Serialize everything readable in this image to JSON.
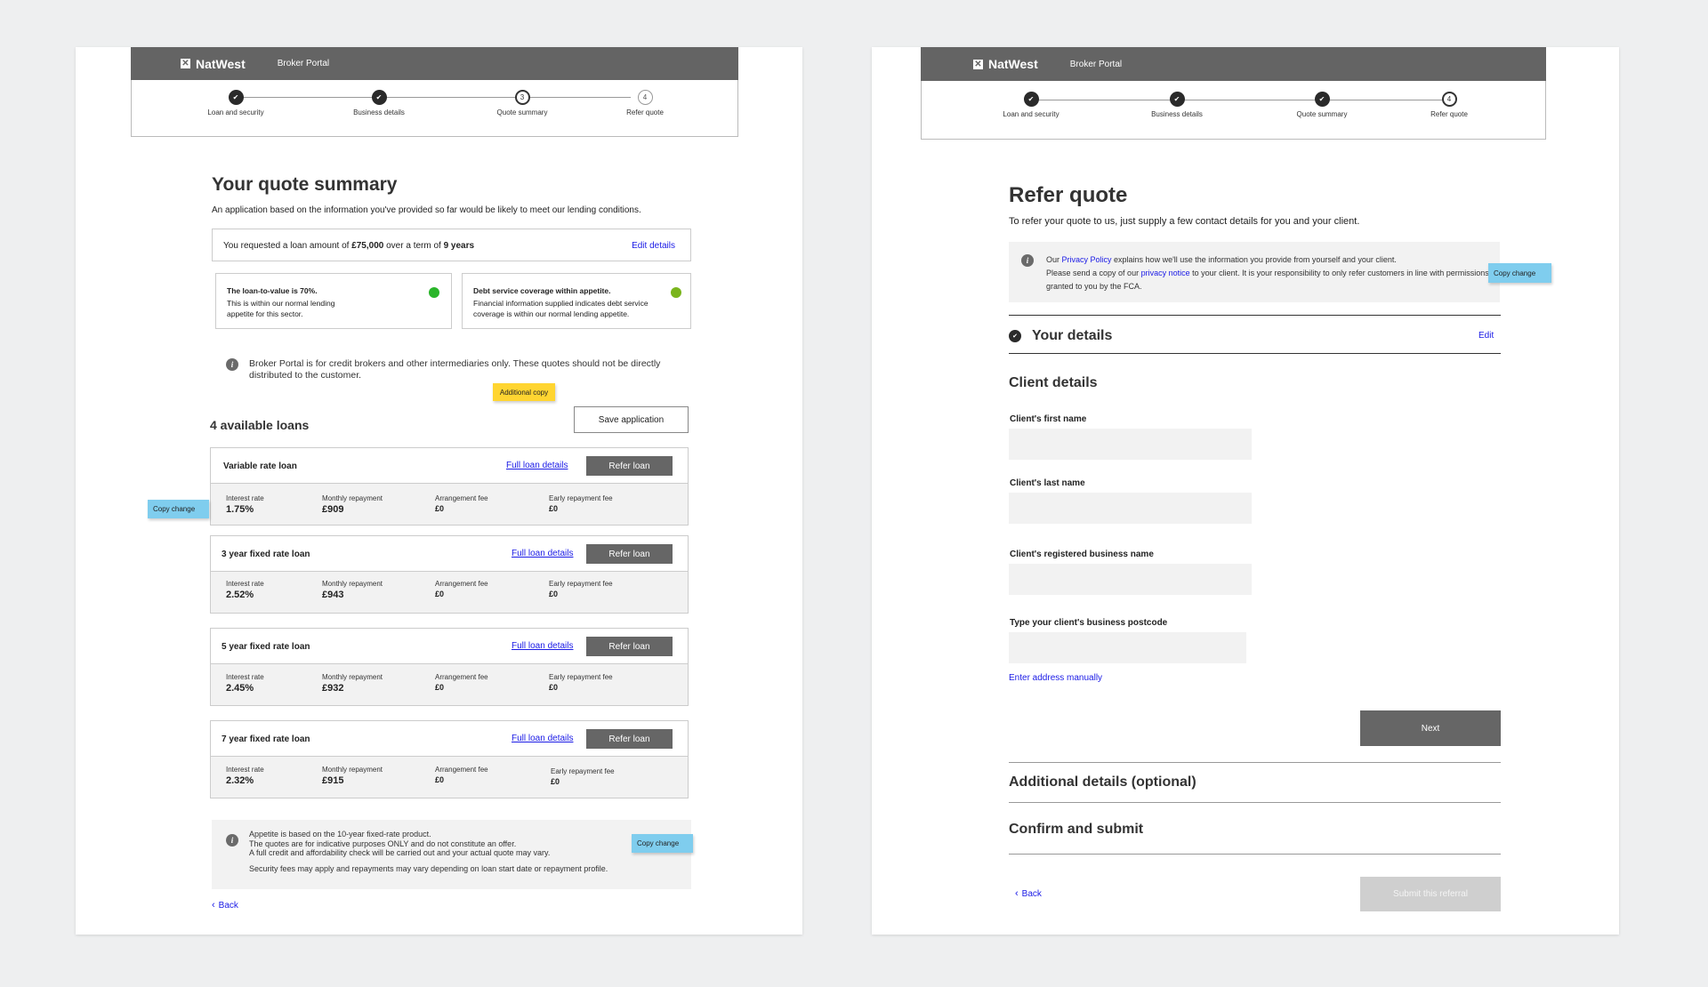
{
  "brand": "NatWest",
  "portal": "Broker Portal",
  "steps": [
    "Loan and security",
    "Business details",
    "Quote summary",
    "Refer quote"
  ],
  "step_numbers": [
    "3",
    "4"
  ],
  "left": {
    "title": "Your quote summary",
    "intro": "An application based on the information you've provided so far would be likely to meet our lending conditions.",
    "request_prefix": "You requested a loan amount of ",
    "amount": "£75,000",
    "request_mid": " over a term of ",
    "term": "9 years",
    "edit_details": "Edit details",
    "ltv_title": "The loan-to-value is 70%.",
    "ltv_body": "This is within our normal lending appetite for this sector.",
    "dsc_title": "Debt service coverage within appetite.",
    "dsc_body": "Financial information supplied indicates debt service coverage is within our normal lending appetite.",
    "status_color": "#2ab52a",
    "status_color_2": "#7ab51d",
    "notice": "Broker Portal is for credit brokers and other intermediaries only. These quotes should not be directly distributed to the customer.",
    "sticky_additional": "Additional copy",
    "available": "4 available loans",
    "save": "Save application",
    "full_details": "Full loan details",
    "refer": "Refer loan",
    "col_labels": [
      "Interest rate",
      "Monthly repayment",
      "Arrangement fee",
      "Early repayment fee"
    ],
    "loans": [
      {
        "name": "Variable rate loan",
        "rate": "1.75%",
        "monthly": "£909",
        "arr": "£0",
        "early": "£0"
      },
      {
        "name": "3 year fixed rate loan",
        "rate": "2.52%",
        "monthly": "£943",
        "arr": "£0",
        "early": "£0"
      },
      {
        "name": "5 year fixed rate loan",
        "rate": "2.45%",
        "monthly": "£932",
        "arr": "£0",
        "early": "£0"
      },
      {
        "name": "7 year fixed rate loan",
        "rate": "2.32%",
        "monthly": "£915",
        "arr": "£0",
        "early": "£0"
      }
    ],
    "sticky_copy": "Copy change",
    "appetite_1": "Appetite is based on the 10-year fixed-rate product.",
    "appetite_2": "The quotes are for indicative purposes ONLY and do not constitute an offer.",
    "appetite_3": "A full credit and affordability check will be carried out and your actual quote may vary.",
    "appetite_4": "Security fees may apply and repayments may vary depending on loan start date or repayment profile.",
    "back": "Back"
  },
  "right": {
    "title": "Refer quote",
    "intro": "To refer your quote to us, just supply a few contact details for you and your client.",
    "privacy_1": "Our ",
    "privacy_link": "Privacy Policy",
    "privacy_2": " explains how we'll use the information you provide from yourself and your client.",
    "privacy_3": "Please send a copy of our ",
    "privacy_notice": "privacy notice",
    "privacy_4": " to your client. It is your responsibility to only refer customers in line with permissions granted to you by the FCA.",
    "sticky_copy": "Copy change",
    "your_details": "Your details",
    "edit": "Edit",
    "client_details": "Client details",
    "first_name": "Client's first name",
    "last_name": "Client's last name",
    "business_name": "Client's registered business name",
    "postcode": "Type your client's business postcode",
    "enter_manual": "Enter address manually",
    "next": "Next",
    "additional": "Additional details (optional)",
    "confirm": "Confirm and submit",
    "back": "Back",
    "submit": "Submit this referral"
  }
}
